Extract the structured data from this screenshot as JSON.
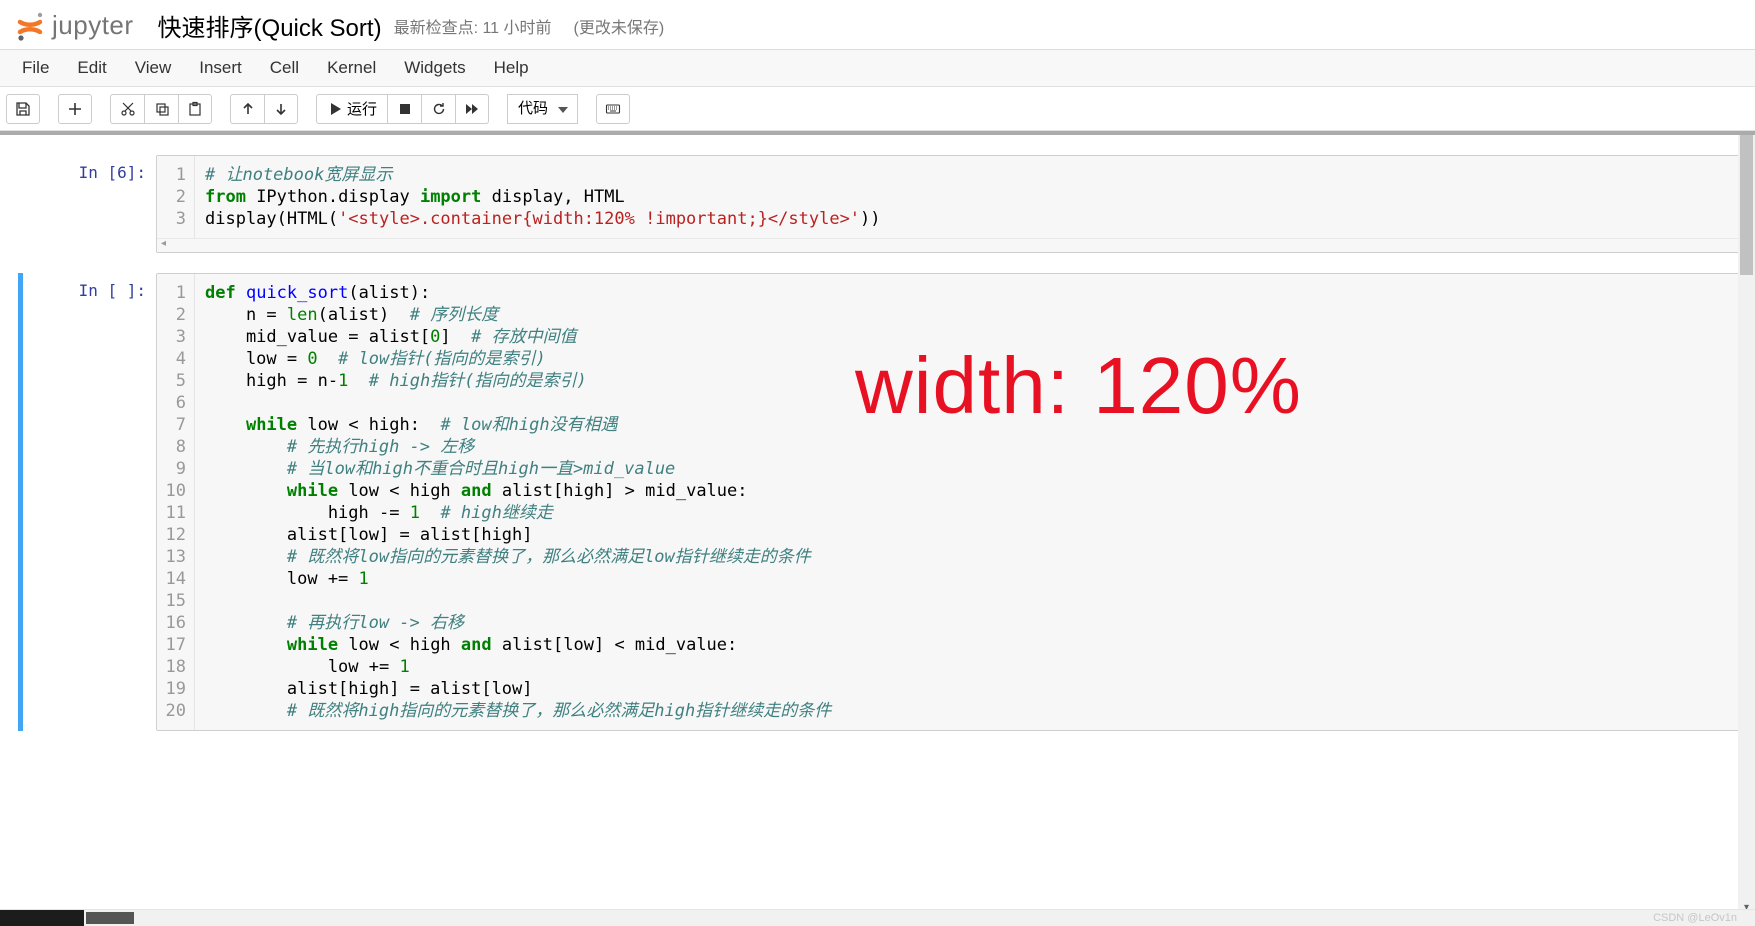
{
  "header": {
    "logo_text": "jupyter",
    "title": "快速排序(Quick Sort)",
    "checkpoint": "最新检查点: 11 小时前",
    "unsaved": "(更改未保存)"
  },
  "menu": [
    "File",
    "Edit",
    "View",
    "Insert",
    "Cell",
    "Kernel",
    "Widgets",
    "Help"
  ],
  "toolbar": {
    "run_label": "运行",
    "celltype_selected": "代码"
  },
  "cells": [
    {
      "prompt": "In  [6]:",
      "gutter": [
        "1",
        "2",
        "3"
      ],
      "code_html": "<span class='c-cm'># 让notebook宽屏显示</span>\n<span class='c-kw'>from</span> IPython.display <span class='c-kw'>import</span> display, HTML\ndisplay(HTML(<span class='c-str'>'&lt;style&gt;.container{width:120% !important;}&lt;/style&gt;'</span>))"
    },
    {
      "prompt": "In  [ ]:",
      "selected": true,
      "gutter": [
        "1",
        "2",
        "3",
        "4",
        "5",
        "6",
        "7",
        "8",
        "9",
        "10",
        "11",
        "12",
        "13",
        "14",
        "15",
        "16",
        "17",
        "18",
        "19",
        "20"
      ],
      "code_html": "<span class='c-kw'>def</span> <span class='c-def'>quick_sort</span>(alist):\n    n = <span class='c-bn'>len</span>(alist)  <span class='c-cm'># 序列长度</span>\n    mid_value = alist[<span class='c-num'>0</span>]  <span class='c-cm'># 存放中间值</span>\n    low = <span class='c-num'>0</span>  <span class='c-cm'># low指针(指向的是索引)</span>\n    high = n-<span class='c-num'>1</span>  <span class='c-cm'># high指针(指向的是索引)</span>\n\n    <span class='c-kw'>while</span> low &lt; high:  <span class='c-cm'># low和high没有相遇</span>\n        <span class='c-cm'># 先执行high -&gt; 左移</span>\n        <span class='c-cm'># 当low和high不重合时且high一直&gt;mid_value</span>\n        <span class='c-kw'>while</span> low &lt; high <span class='c-kw'>and</span> alist[high] &gt; mid_value:\n            high -= <span class='c-num'>1</span>  <span class='c-cm'># high继续走</span>\n        alist[low] = alist[high]\n        <span class='c-cm'># 既然将low指向的元素替换了，那么必然满足low指针继续走的条件</span>\n        low += <span class='c-num'>1</span>\n\n        <span class='c-cm'># 再执行low -&gt; 右移</span>\n        <span class='c-kw'>while</span> low &lt; high <span class='c-kw'>and</span> alist[low] &lt; mid_value:\n            low += <span class='c-num'>1</span>\n        alist[high] = alist[low]\n        <span class='c-cm'># 既然将high指向的元素替换了，那么必然满足high指针继续走的条件</span>"
    }
  ],
  "annotation": "width: 120%",
  "watermark": "CSDN @LeOv1n"
}
